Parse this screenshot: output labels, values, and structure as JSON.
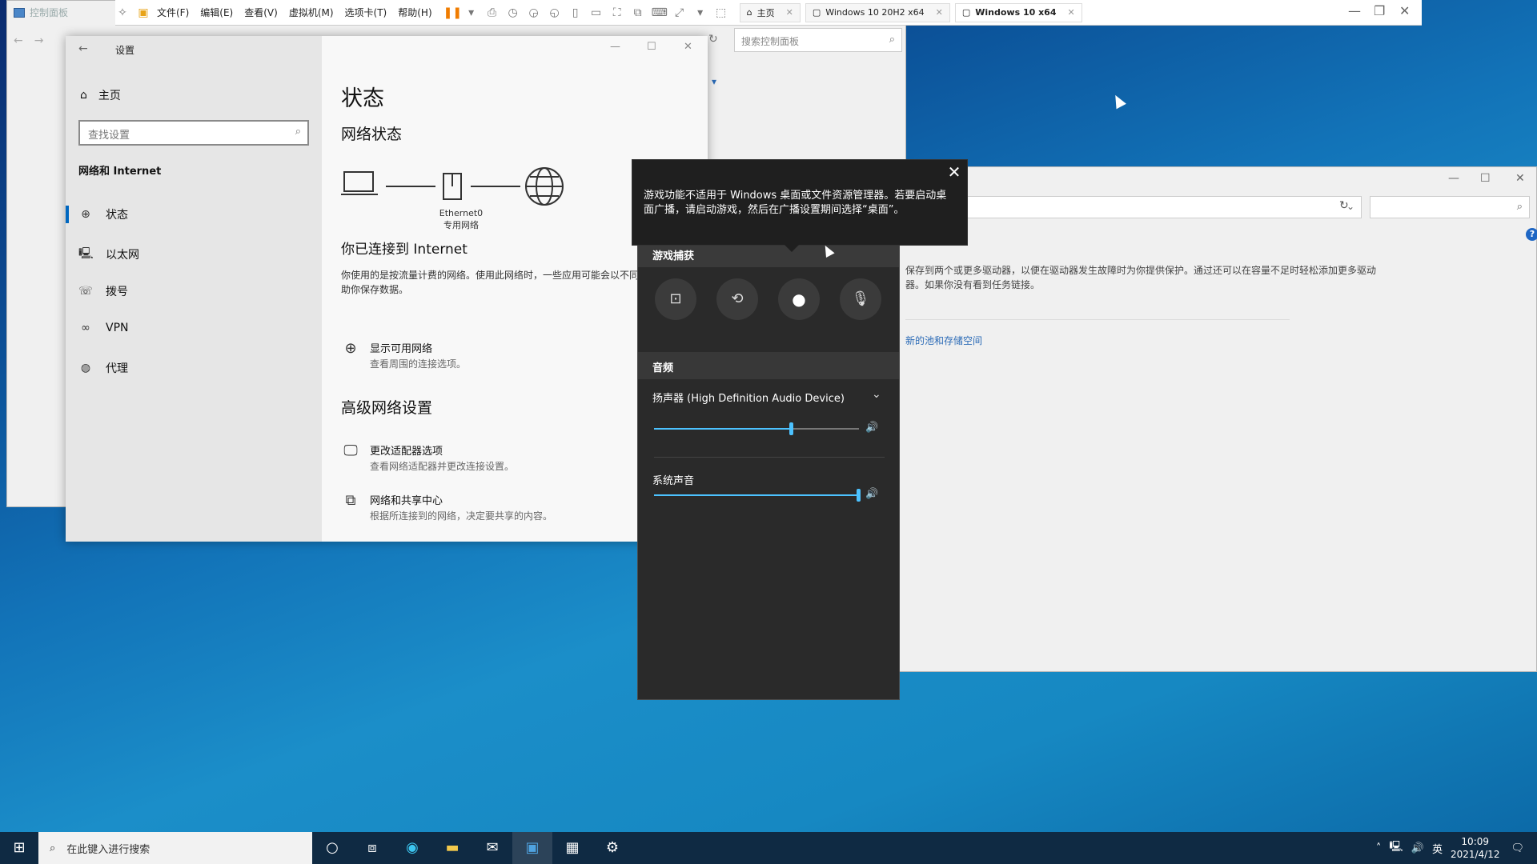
{
  "control_panel": {
    "title": "控制面板",
    "search_placeholder": "搜索控制面板"
  },
  "storage_window": {
    "description": "保存到两个或更多驱动器，以便在驱动器发生故障时为你提供保护。通过还可以在容量不足时轻松添加更多驱动器。如果你没有看到任务链接。",
    "link": "新的池和存储空间"
  },
  "vmware": {
    "menu": [
      "文件(F)",
      "编辑(E)",
      "查看(V)",
      "虚拟机(M)",
      "选项卡(T)",
      "帮助(H)"
    ],
    "tabs": [
      "主页",
      "Windows 10 20H2 x64",
      "Windows 10 x64"
    ]
  },
  "settings": {
    "title": "设置",
    "home": "主页",
    "search_placeholder": "查找设置",
    "category": "网络和 Internet",
    "nav": [
      "状态",
      "以太网",
      "拨号",
      "VPN",
      "代理"
    ],
    "page_title": "状态",
    "section": "网络状态",
    "adapter": "Ethernet0",
    "network_type": "专用网络",
    "connected_heading": "你已连接到 Internet",
    "connected_desc": "你使用的是按流量计费的网络。使用此网络时，一些应用可能会以不同方式工作，以帮助你保存数据。",
    "show_networks": "显示可用网络",
    "show_networks_desc": "查看周围的连接选项。",
    "advanced_heading": "高级网络设置",
    "adapter_options": "更改适配器选项",
    "adapter_options_desc": "查看网络适配器并更改连接设置。",
    "sharing_center": "网络和共享中心",
    "sharing_center_desc": "根据所连接到的网络，决定要共享的内容。"
  },
  "gamebar": {
    "capture_header": "游戏捕获",
    "audio_header": "音频",
    "speaker": "扬声器 (High Definition Audio Device)",
    "speaker_level": 0.67,
    "system_sound": "系统声音",
    "system_level": 1.0
  },
  "tooltip": {
    "text": "游戏功能不适用于 Windows 桌面或文件资源管理器。若要启动桌面广播，请启动游戏，然后在广播设置期间选择“桌面”。"
  },
  "taskbar": {
    "search_placeholder": "在此键入进行搜索",
    "time": "10:09",
    "date": "2021/4/12",
    "ime": "英"
  }
}
